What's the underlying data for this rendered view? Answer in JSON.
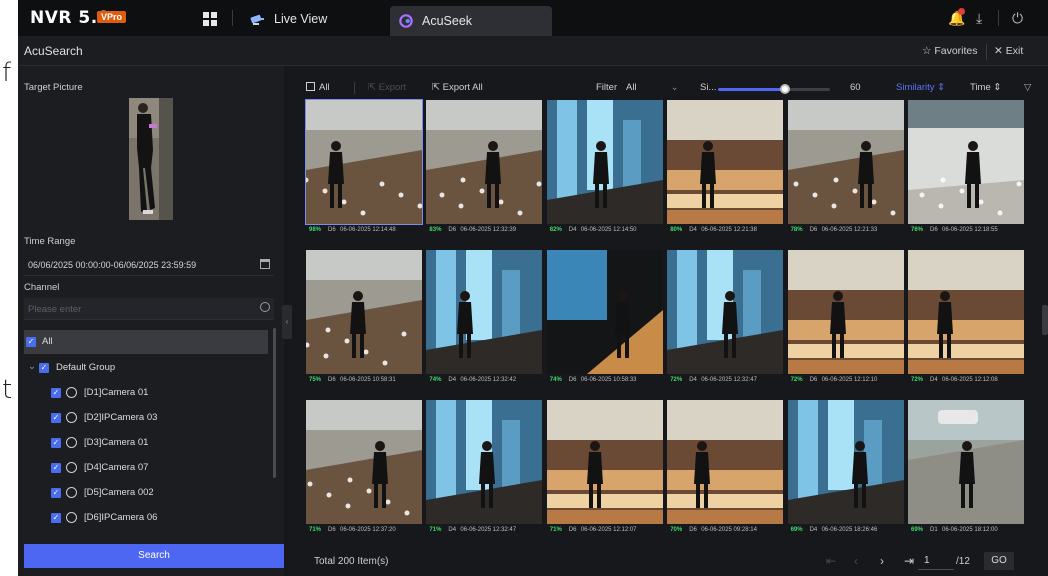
{
  "stray_text": {
    "top": "f",
    "bottom": "t"
  },
  "topbar": {
    "brand": "NVR 5.0",
    "brand_badge": "VPro",
    "tabs": [
      {
        "label": "Live View"
      },
      {
        "label": "AcuSeek"
      }
    ]
  },
  "subheader": {
    "title": "AcuSearch",
    "favorites": "Favorites",
    "exit": "Exit"
  },
  "left": {
    "target_label": "Target Picture",
    "time_label": "Time Range",
    "time_value": "06/06/2025 00:00:00-06/06/2025 23:59:59",
    "channel_label": "Channel",
    "channel_placeholder": "Please enter",
    "tree": [
      {
        "label": "All"
      },
      {
        "label": "Default Group"
      },
      {
        "label": "[D1]Camera 01"
      },
      {
        "label": "[D2]IPCamera 03"
      },
      {
        "label": "[D3]Camera 01"
      },
      {
        "label": "[D4]Camera 07"
      },
      {
        "label": "[D5]Camera 002"
      },
      {
        "label": "[D6]IPCamera 06"
      }
    ],
    "search_button": "Search"
  },
  "toolbar": {
    "all": "All",
    "export": "Export",
    "export_all": "Export All",
    "filter_label": "Filter",
    "filter_value": "All",
    "slider_label": "Si...",
    "slider_value": 60,
    "slider_fraction": 0.6,
    "sort_similarity": "Similarity",
    "sort_time": "Time"
  },
  "results": [
    {
      "pct": "98%",
      "cam": "D6",
      "ts": "06-06-2025 12:14:48",
      "scene": "floor"
    },
    {
      "pct": "83%",
      "cam": "D6",
      "ts": "06-06-2025 12:32:39",
      "scene": "floor"
    },
    {
      "pct": "82%",
      "cam": "D4",
      "ts": "06-06-2025 12:14:50",
      "scene": "glass"
    },
    {
      "pct": "80%",
      "cam": "D4",
      "ts": "06-06-2025 12:21:38",
      "scene": "bakery"
    },
    {
      "pct": "78%",
      "cam": "D6",
      "ts": "06-06-2025 12:21:33",
      "scene": "floor"
    },
    {
      "pct": "76%",
      "cam": "D6",
      "ts": "06-06-2025 12:18:55",
      "scene": "bright"
    },
    {
      "pct": "75%",
      "cam": "D6",
      "ts": "06-06-2025 10:58:31",
      "scene": "floor"
    },
    {
      "pct": "74%",
      "cam": "D4",
      "ts": "06-06-2025 12:32:42",
      "scene": "glass"
    },
    {
      "pct": "74%",
      "cam": "D6",
      "ts": "06-06-2025 10:58:33",
      "scene": "dark"
    },
    {
      "pct": "72%",
      "cam": "D4",
      "ts": "06-06-2025 12:32:47",
      "scene": "glass"
    },
    {
      "pct": "72%",
      "cam": "D6",
      "ts": "06-06-2025 12:12:10",
      "scene": "bakery"
    },
    {
      "pct": "72%",
      "cam": "D4",
      "ts": "06-06-2025 12:12:08",
      "scene": "bakery"
    },
    {
      "pct": "71%",
      "cam": "D6",
      "ts": "06-06-2025 12:37:20",
      "scene": "floor"
    },
    {
      "pct": "71%",
      "cam": "D4",
      "ts": "06-06-2025 12:32:47",
      "scene": "glass"
    },
    {
      "pct": "71%",
      "cam": "D6",
      "ts": "06-06-2025 12:12:07",
      "scene": "bakery"
    },
    {
      "pct": "70%",
      "cam": "D6",
      "ts": "06-06-2025 09:28:14",
      "scene": "bakery"
    },
    {
      "pct": "69%",
      "cam": "D4",
      "ts": "06-06-2025 18:26:46",
      "scene": "glass"
    },
    {
      "pct": "69%",
      "cam": "D1",
      "ts": "06-06-2025 18:12:00",
      "scene": "street"
    }
  ],
  "footer": {
    "total": "Total 200 Item(s)",
    "page": "1",
    "pages": "/12",
    "go": "GO"
  },
  "colors": {
    "accent": "#4e67f3",
    "similarity_green": "#3ddc6a",
    "bg": "#17181b"
  }
}
